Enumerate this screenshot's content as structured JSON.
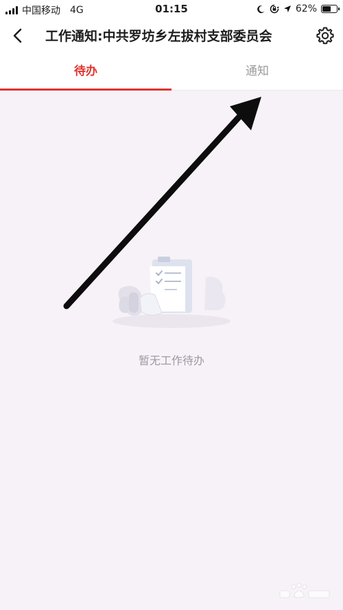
{
  "status_bar": {
    "carrier": "中国移动",
    "network": "4G",
    "time": "01:15",
    "battery_percent": "62%",
    "battery_level": 0.62,
    "icons": [
      "signal-icon",
      "moon-icon",
      "orientation-lock-icon",
      "location-icon",
      "battery-icon"
    ]
  },
  "nav": {
    "title": "工作通知:中共罗坊乡左拔村支部委员会",
    "back_icon": "chevron-left-icon",
    "settings_icon": "gear-icon"
  },
  "tabs": [
    {
      "label": "待办",
      "active": true
    },
    {
      "label": "通知",
      "active": false
    }
  ],
  "empty_state": {
    "icon": "clipboard-checklist-icon",
    "text": "暂无工作待办"
  },
  "colors": {
    "accent": "#e0332f",
    "background": "#f7f2f8",
    "tab_inactive": "#9b9b9b",
    "annotation_arrow": "#0d0d0d"
  },
  "annotation": {
    "icon": "arrow-annotation-icon"
  }
}
